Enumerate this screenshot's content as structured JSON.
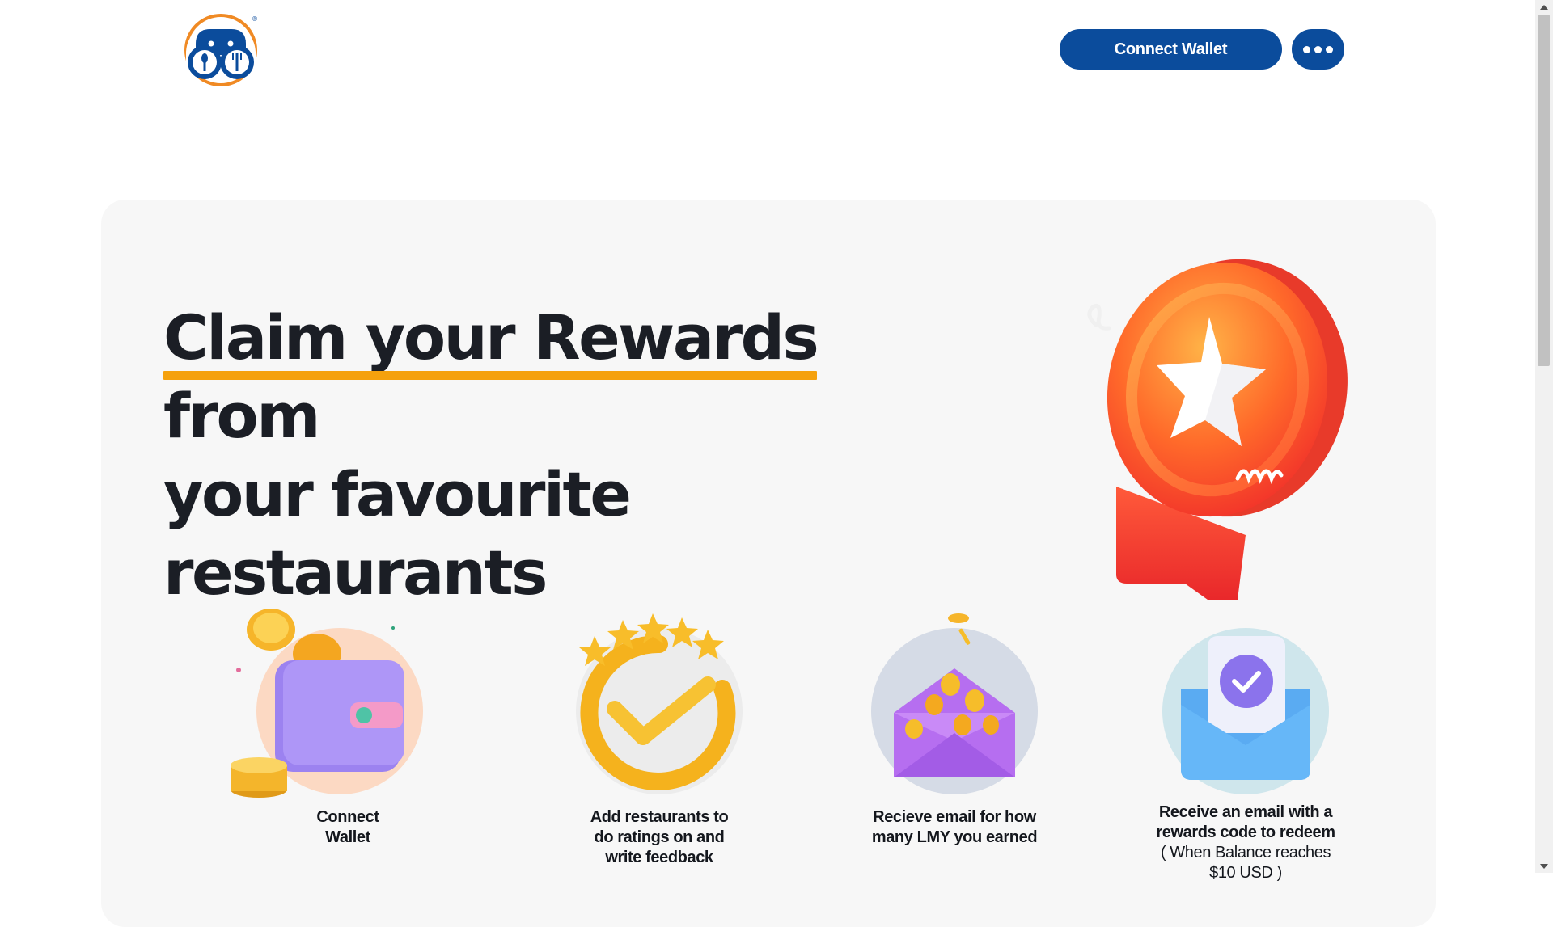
{
  "header": {
    "logo_icon": "binoculars-fork-spoon-logo",
    "connect_wallet_label": "Connect Wallet",
    "more_icon": "more-dots-icon",
    "accent_color": "#0b4c9c"
  },
  "hero": {
    "title_part1": "Claim your Rewards",
    "title_part2": " from",
    "title_line2": "your favourite restaurants",
    "underline_color": "#f5a10d",
    "illustration": "star-medal-badge"
  },
  "steps": [
    {
      "icon": "wallet-coins-icon",
      "line1": "Connect",
      "line2": "Wallet"
    },
    {
      "icon": "checkmark-stars-icon",
      "line1": "Add restaurants to",
      "line2": "do ratings on and",
      "line3": "write feedback"
    },
    {
      "icon": "envelope-coins-icon",
      "line1": "Recieve email for how",
      "line2": "many LMY you earned"
    },
    {
      "icon": "email-checkmark-icon",
      "line1": "Receive an email with a",
      "line2": "rewards code to redeem",
      "line3": "( When Balance reaches",
      "line4": "$10 USD )"
    }
  ]
}
